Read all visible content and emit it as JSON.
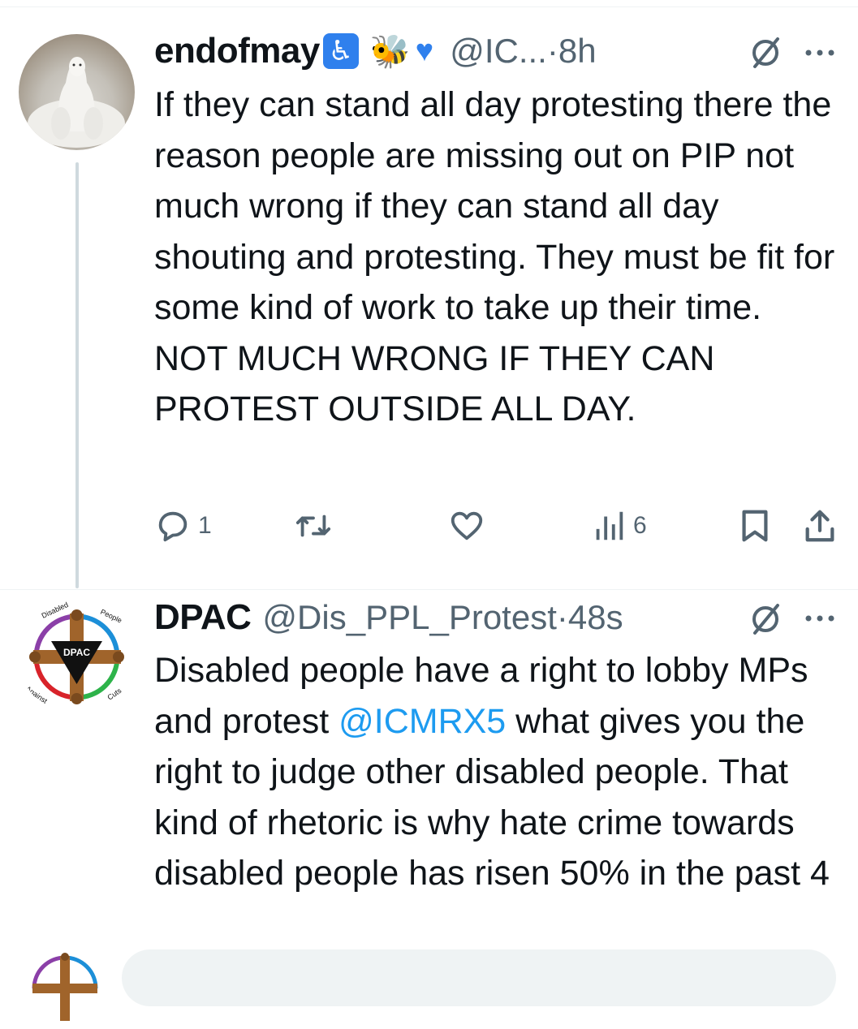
{
  "tweets": [
    {
      "name": "endofmay",
      "badges": [
        "wheelchair-icon",
        "bee-emoji",
        "blue-heart-emoji"
      ],
      "handle": "@IC...",
      "dot": "·",
      "time": "8h",
      "text": "If they can stand all day protesting there the reason people are missing out on PIP not much wrong if they can stand all day shouting and protesting. They must be fit for some kind of work to take up their time. NOT MUCH WRONG IF THEY CAN PROTEST OUTSIDE ALL DAY.",
      "actions": {
        "reply_count": "1",
        "retweet_count": "",
        "like_count": "",
        "views_count": "6"
      }
    },
    {
      "name": "DPAC",
      "handle": "@Dis_PPL_Protest",
      "dot": "·",
      "time": "48s",
      "text_before": "Disabled people have a right to lobby MPs and protest ",
      "mention": "@ICMRX5",
      "text_after": " what gives you the right to judge other disabled people. That kind of rhetoric is why hate crime towards disabled people has risen 50% in the past 4"
    }
  ],
  "logo": {
    "label": "DPAC",
    "ring_top_left": "Disabled",
    "ring_top_right": "People",
    "ring_bottom_left": "Against",
    "ring_bottom_right": "Cuts"
  },
  "colors": {
    "accent": "#1d9bf0",
    "muted": "#536471",
    "text": "#0f1419",
    "thread_line": "#cfd9de"
  }
}
